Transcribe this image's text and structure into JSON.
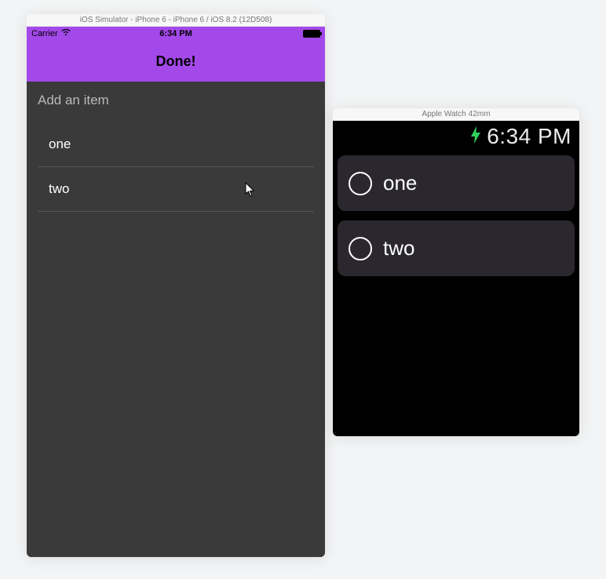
{
  "iphone": {
    "window_title": "iOS Simulator - iPhone 6 - iPhone 6 / iOS 8.2 (12D508)",
    "statusbar": {
      "carrier": "Carrier",
      "time": "6:34 PM"
    },
    "navbar": {
      "done_label": "Done!"
    },
    "input": {
      "placeholder": "Add an item"
    },
    "items": [
      {
        "label": "one"
      },
      {
        "label": "two"
      }
    ]
  },
  "watch": {
    "window_title": "Apple Watch 42mm",
    "statusbar": {
      "time": "6:34 PM"
    },
    "items": [
      {
        "label": "one"
      },
      {
        "label": "two"
      }
    ]
  }
}
